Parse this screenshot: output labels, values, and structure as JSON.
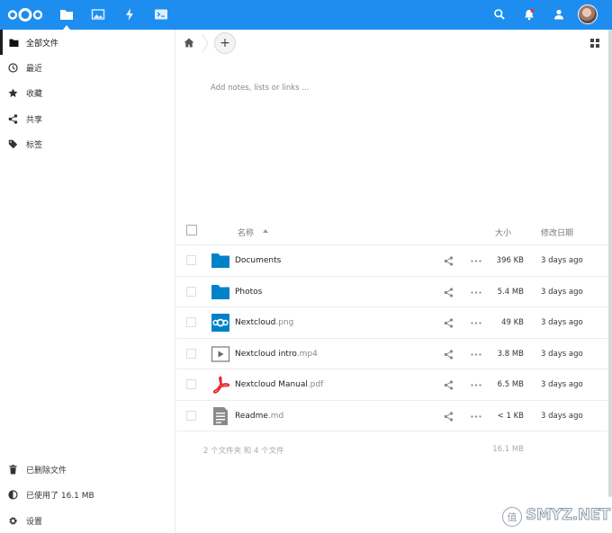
{
  "header": {
    "brand_color": "#1d8ef0",
    "apps": [
      {
        "name": "files",
        "icon": "folder-icon",
        "active": true
      },
      {
        "name": "photos",
        "icon": "image-icon",
        "active": false
      },
      {
        "name": "activity",
        "icon": "lightning-icon",
        "active": false
      },
      {
        "name": "terminal",
        "icon": "terminal-icon",
        "active": false
      }
    ],
    "right_icons": [
      "search-icon",
      "bell-icon",
      "contacts-icon",
      "avatar"
    ]
  },
  "sidebar": {
    "items": [
      {
        "label": "全部文件",
        "icon": "folder-icon",
        "active": true
      },
      {
        "label": "最近",
        "icon": "clock-icon",
        "active": false
      },
      {
        "label": "收藏",
        "icon": "star-icon",
        "active": false
      },
      {
        "label": "共享",
        "icon": "share-icon",
        "active": false
      },
      {
        "label": "标签",
        "icon": "tag-icon",
        "active": false
      }
    ],
    "footer": {
      "deleted_label": "已删除文件",
      "quota_label": "已使用了 16.1 MB",
      "settings_label": "设置"
    }
  },
  "main": {
    "notes_placeholder": "Add notes, lists or links ...",
    "add_label": "+",
    "table": {
      "col_name": "名称",
      "col_size": "大小",
      "col_date": "修改日期"
    },
    "files": [
      {
        "base": "Documents",
        "ext": "",
        "size": "396 KB",
        "date": "3 days ago",
        "icon": "folder-icon"
      },
      {
        "base": "Photos",
        "ext": "",
        "size": "5.4 MB",
        "date": "3 days ago",
        "icon": "folder-icon"
      },
      {
        "base": "Nextcloud",
        "ext": ".png",
        "size": "49 KB",
        "date": "3 days ago",
        "icon": "image-file-icon"
      },
      {
        "base": "Nextcloud intro",
        "ext": ".mp4",
        "size": "3.8 MB",
        "date": "3 days ago",
        "icon": "video-file-icon"
      },
      {
        "base": "Nextcloud Manual",
        "ext": ".pdf",
        "size": "6.5 MB",
        "date": "3 days ago",
        "icon": "pdf-file-icon"
      },
      {
        "base": "Readme",
        "ext": ".md",
        "size": "< 1 KB",
        "date": "3 days ago",
        "icon": "text-file-icon"
      }
    ],
    "summary": {
      "count": "2 个文件夹 和 4 个文件",
      "total": "16.1 MB"
    }
  },
  "watermark": {
    "badge": "值",
    "text": "SMYZ.NET"
  }
}
